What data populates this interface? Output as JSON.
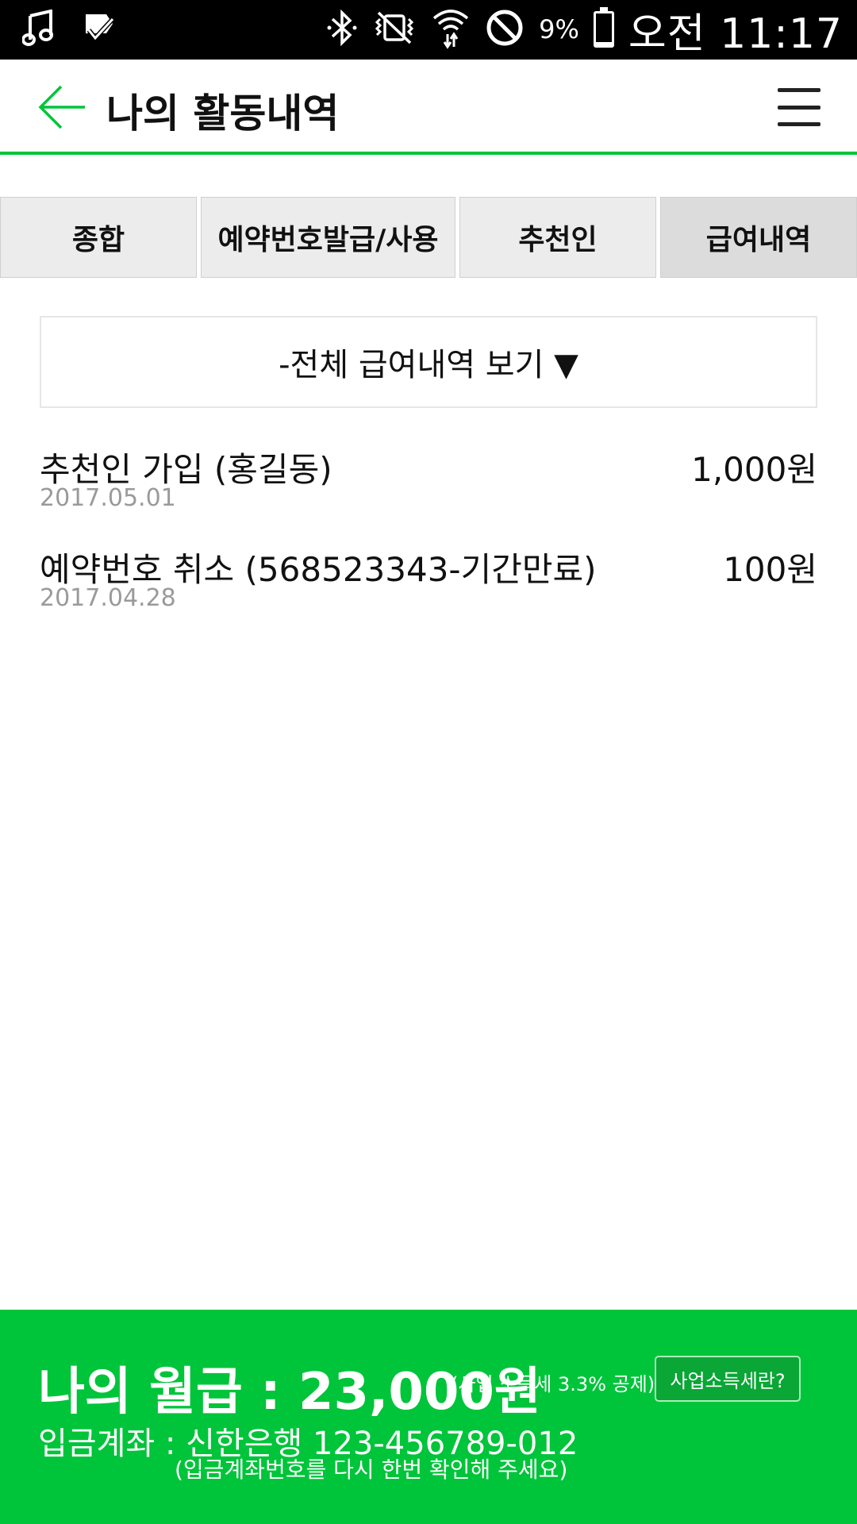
{
  "status_bar": {
    "battery_percent_label": "9%",
    "battery_level": 0.09,
    "time": "오전 11:17",
    "icons": [
      "music-note-icon",
      "check-notification-icon",
      "bluetooth-icon",
      "vibrate-icon",
      "wifi-icon",
      "do-not-disturb-icon",
      "battery-icon"
    ]
  },
  "header": {
    "title": "나의 활동내역",
    "back_icon": "arrow-left-icon",
    "menu_icon": "hamburger-menu-icon"
  },
  "tabs": [
    {
      "label": "종합",
      "active": false
    },
    {
      "label": "예약번호발급/사용",
      "active": false
    },
    {
      "label": "추천인",
      "active": false
    },
    {
      "label": "급여내역",
      "active": true
    }
  ],
  "filter": {
    "label": "-전체 급여내역 보기 ▼"
  },
  "history": [
    {
      "title": "추천인 가입 (홍길동)",
      "amount": "1,000원",
      "date": "2017.05.01"
    },
    {
      "title": "예약번호 취소 (568523343-기간만료)",
      "amount": "100원",
      "date": "2017.04.28"
    }
  ],
  "footer": {
    "salary_label": "나의 월급 : 23,000원",
    "tax_note": "(사업 소득세 3.3% 공제)",
    "tax_button": "사업소득세란?",
    "account": "입금계좌 : 신한은행 123-456789-012",
    "account_note": "(입금계좌번호를 다시 한번 확인해 주세요)"
  },
  "colors": {
    "accent": "#00c43a",
    "status_bar": "#000000",
    "tab_bg": "#ececec",
    "tab_active_bg": "#dcdcdc",
    "date_text": "#9a9a9a"
  }
}
